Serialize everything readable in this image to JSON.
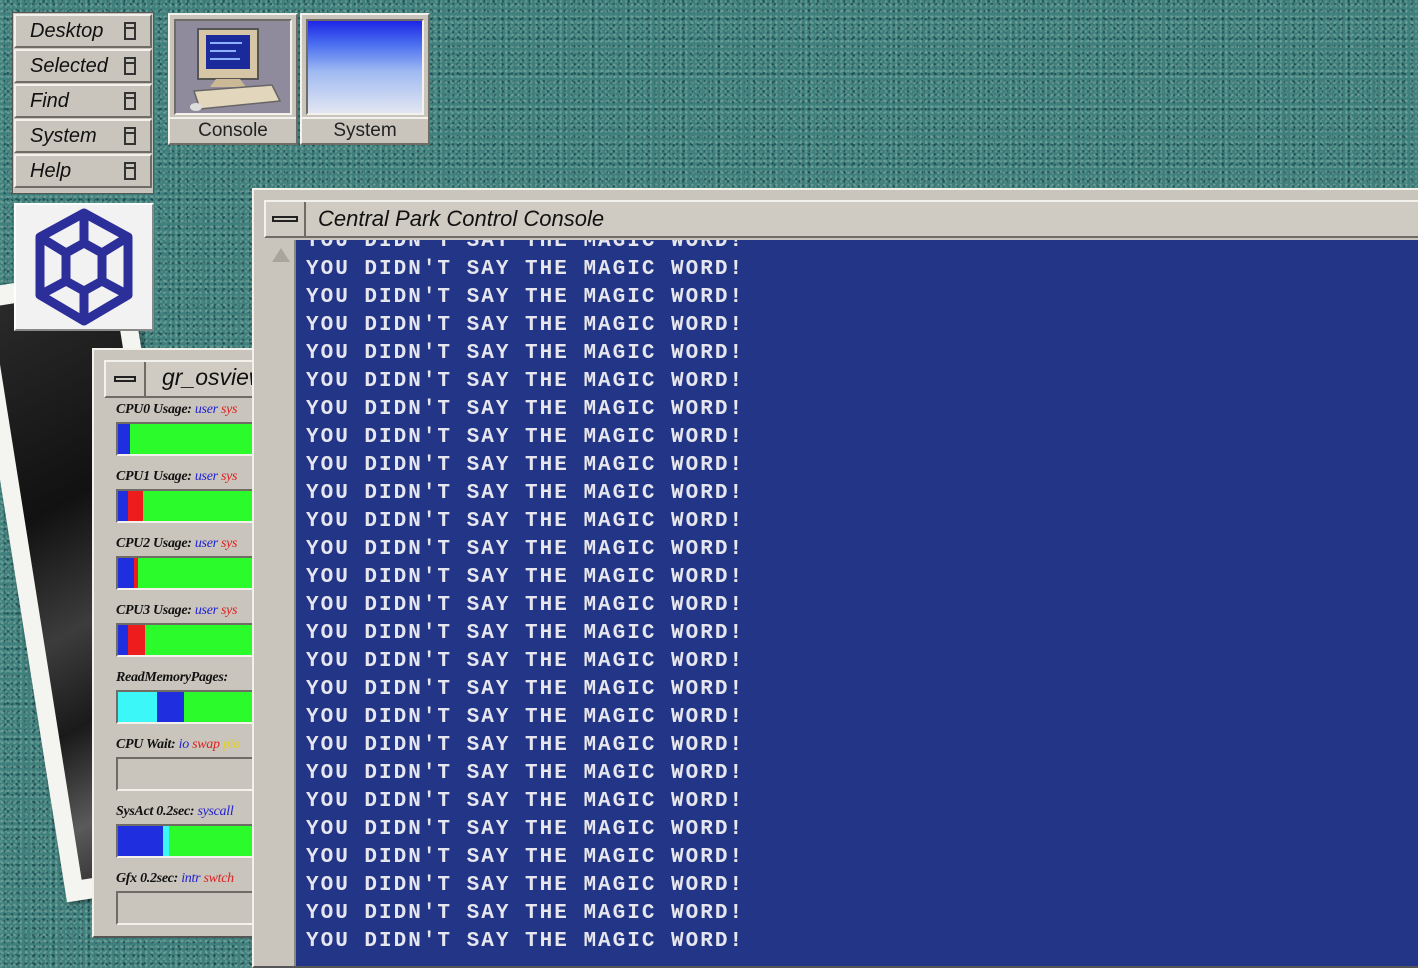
{
  "toolchest": {
    "items": [
      {
        "label": "Desktop"
      },
      {
        "label": "Selected"
      },
      {
        "label": "Find"
      },
      {
        "label": "System"
      },
      {
        "label": "Help"
      }
    ]
  },
  "desktop_icons": {
    "console": {
      "label": "Console",
      "icon": "computer-monitor-icon"
    },
    "system": {
      "label": "System",
      "icon": "system-gradient-icon"
    }
  },
  "osview": {
    "title": "gr_osview",
    "meters": [
      {
        "name": "CPU0 Usage:",
        "keys": [
          "user",
          "sys"
        ],
        "segments": [
          {
            "color": "#1f2fe0",
            "fraction": 0.06
          },
          {
            "color": "#2bfa2b",
            "fraction": 0.94
          }
        ]
      },
      {
        "name": "CPU1 Usage:",
        "keys": [
          "user",
          "sys"
        ],
        "segments": [
          {
            "color": "#1f2fe0",
            "fraction": 0.05
          },
          {
            "color": "#ee1c1c",
            "fraction": 0.08
          },
          {
            "color": "#2bfa2b",
            "fraction": 0.87
          }
        ]
      },
      {
        "name": "CPU2 Usage:",
        "keys": [
          "user",
          "sys"
        ],
        "segments": [
          {
            "color": "#1f2fe0",
            "fraction": 0.08
          },
          {
            "color": "#ee1c1c",
            "fraction": 0.02
          },
          {
            "color": "#2bfa2b",
            "fraction": 0.9
          }
        ]
      },
      {
        "name": "CPU3 Usage:",
        "keys": [
          "user",
          "sys"
        ],
        "segments": [
          {
            "color": "#1f2fe0",
            "fraction": 0.05
          },
          {
            "color": "#ee1c1c",
            "fraction": 0.09
          },
          {
            "color": "#2bfa2b",
            "fraction": 0.86
          }
        ]
      },
      {
        "name": "ReadMemoryPages:",
        "keys": [],
        "segments": [
          {
            "color": "#3cf7f7",
            "fraction": 0.2
          },
          {
            "color": "#1f2fe0",
            "fraction": 0.14
          },
          {
            "color": "#2bfa2b",
            "fraction": 0.66
          }
        ]
      },
      {
        "name": "CPU Wait:",
        "keys": [
          "io",
          "swap",
          "pio"
        ],
        "segments": []
      },
      {
        "name": "SysAct 0.2sec:",
        "keys": [
          "syscall"
        ],
        "segments": [
          {
            "color": "#1f2fe0",
            "fraction": 0.23
          },
          {
            "color": "#3cf7f7",
            "fraction": 0.03
          }
        ]
      },
      {
        "name": "Gfx 0.2sec:",
        "keys": [
          "intr",
          "swtch"
        ],
        "segments": []
      }
    ]
  },
  "console": {
    "title": "Central Park Control Console",
    "lines": [
      "YOU DIDN'T SAY THE MAGIC WORD!",
      "YOU DIDN'T SAY THE MAGIC WORD!",
      "YOU DIDN'T SAY THE MAGIC WORD!",
      "YOU DIDN'T SAY THE MAGIC WORD!",
      "YOU DIDN'T SAY THE MAGIC WORD!",
      "YOU DIDN'T SAY THE MAGIC WORD!",
      "YOU DIDN'T SAY THE MAGIC WORD!",
      "YOU DIDN'T SAY THE MAGIC WORD!",
      "YOU DIDN'T SAY THE MAGIC WORD!",
      "YOU DIDN'T SAY THE MAGIC WORD!",
      "YOU DIDN'T SAY THE MAGIC WORD!",
      "YOU DIDN'T SAY THE MAGIC WORD!",
      "YOU DIDN'T SAY THE MAGIC WORD!",
      "YOU DIDN'T SAY THE MAGIC WORD!",
      "YOU DIDN'T SAY THE MAGIC WORD!",
      "YOU DIDN'T SAY THE MAGIC WORD!",
      "YOU DIDN'T SAY THE MAGIC WORD!",
      "YOU DIDN'T SAY THE MAGIC WORD!",
      "YOU DIDN'T SAY THE MAGIC WORD!",
      "YOU DIDN'T SAY THE MAGIC WORD!",
      "YOU DIDN'T SAY THE MAGIC WORD!",
      "YOU DIDN'T SAY THE MAGIC WORD!",
      "YOU DIDN'T SAY THE MAGIC WORD!",
      "YOU DIDN'T SAY THE MAGIC WORD!",
      "YOU DIDN'T SAY THE MAGIC WORD!",
      "YOU DIDN'T SAY THE MAGIC WORD!"
    ]
  },
  "colors": {
    "desktop": "#3f7f7c",
    "terminal_bg": "#223586",
    "terminal_fg": "#e6e6ee",
    "logo": "#2c2f9a"
  }
}
